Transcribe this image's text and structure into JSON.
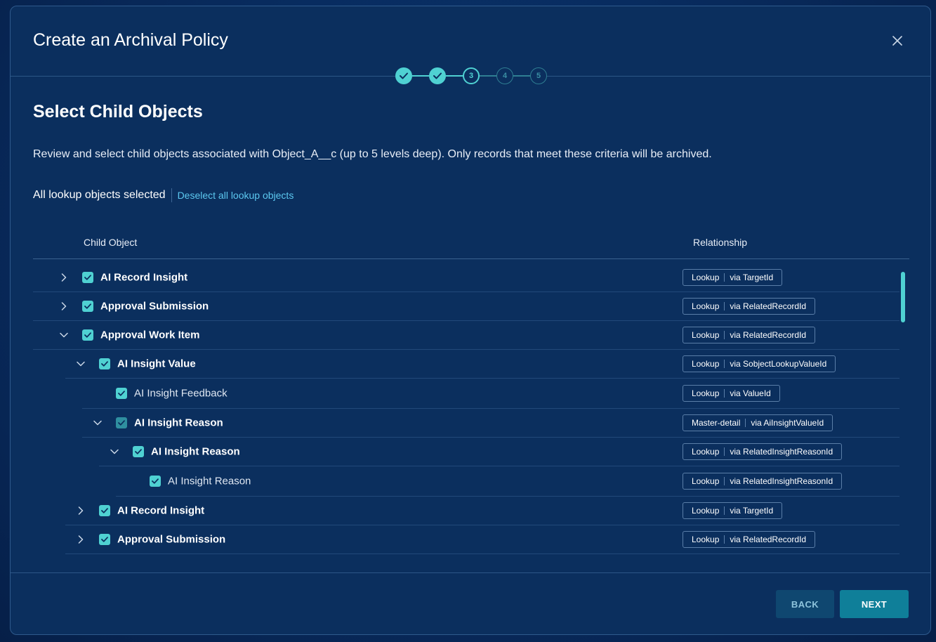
{
  "dialog": {
    "title": "Create an Archival Policy",
    "close_icon": "close-icon"
  },
  "stepper": {
    "steps": [
      {
        "label": "",
        "state": "done",
        "icon": "check-icon"
      },
      {
        "label": "",
        "state": "done",
        "icon": "check-icon"
      },
      {
        "label": "3",
        "state": "current"
      },
      {
        "label": "4",
        "state": "todo"
      },
      {
        "label": "5",
        "state": "todo"
      }
    ]
  },
  "main": {
    "title": "Select Child Objects",
    "description": "Review and select child objects associated with Object_A__c (up to 5 levels deep). Only records that meet these criteria will be archived.",
    "lookup_status": "All lookup objects selected",
    "deselect_link": "Deselect all lookup objects"
  },
  "table": {
    "columns": {
      "child_object": "Child Object",
      "relationship": "Relationship"
    },
    "rows": [
      {
        "label": "AI Record Insight",
        "level": 0,
        "expand": "collapsed",
        "checked": "checked",
        "bold": true,
        "rel_type": "Lookup",
        "rel_via": "via TargetId"
      },
      {
        "label": "Approval Submission",
        "level": 0,
        "expand": "collapsed",
        "checked": "checked",
        "bold": true,
        "rel_type": "Lookup",
        "rel_via": "via RelatedRecordId"
      },
      {
        "label": "Approval Work Item",
        "level": 0,
        "expand": "expanded",
        "checked": "checked",
        "bold": true,
        "rel_type": "Lookup",
        "rel_via": "via RelatedRecordId"
      },
      {
        "label": "AI Insight Value",
        "level": 1,
        "expand": "expanded",
        "checked": "checked",
        "bold": true,
        "rel_type": "Lookup",
        "rel_via": "via SobjectLookupValueId"
      },
      {
        "label": "AI Insight Feedback",
        "level": 2,
        "expand": "none",
        "checked": "checked",
        "bold": false,
        "rel_type": "Lookup",
        "rel_via": "via ValueId"
      },
      {
        "label": "AI Insight Reason",
        "level": 2,
        "expand": "expanded",
        "checked": "partial",
        "bold": true,
        "rel_type": "Master-detail",
        "rel_via": "via AiInsightValueId"
      },
      {
        "label": "AI Insight Reason",
        "level": 3,
        "expand": "expanded",
        "checked": "checked",
        "bold": true,
        "rel_type": "Lookup",
        "rel_via": "via RelatedInsightReasonId"
      },
      {
        "label": "AI Insight Reason",
        "level": 4,
        "expand": "none",
        "checked": "checked",
        "bold": false,
        "rel_type": "Lookup",
        "rel_via": "via RelatedInsightReasonId"
      },
      {
        "label": "AI Record Insight",
        "level": 1,
        "expand": "collapsed",
        "checked": "checked",
        "bold": true,
        "rel_type": "Lookup",
        "rel_via": "via TargetId"
      },
      {
        "label": "Approval Submission",
        "level": 1,
        "expand": "collapsed",
        "checked": "checked",
        "bold": true,
        "rel_type": "Lookup",
        "rel_via": "via RelatedRecordId"
      }
    ]
  },
  "footer": {
    "back_label": "BACK",
    "next_label": "NEXT"
  },
  "colors": {
    "accent": "#4fd1d2",
    "background": "#0b2f5e",
    "link": "#5cc8f0",
    "primary_button": "#0f7f99"
  }
}
